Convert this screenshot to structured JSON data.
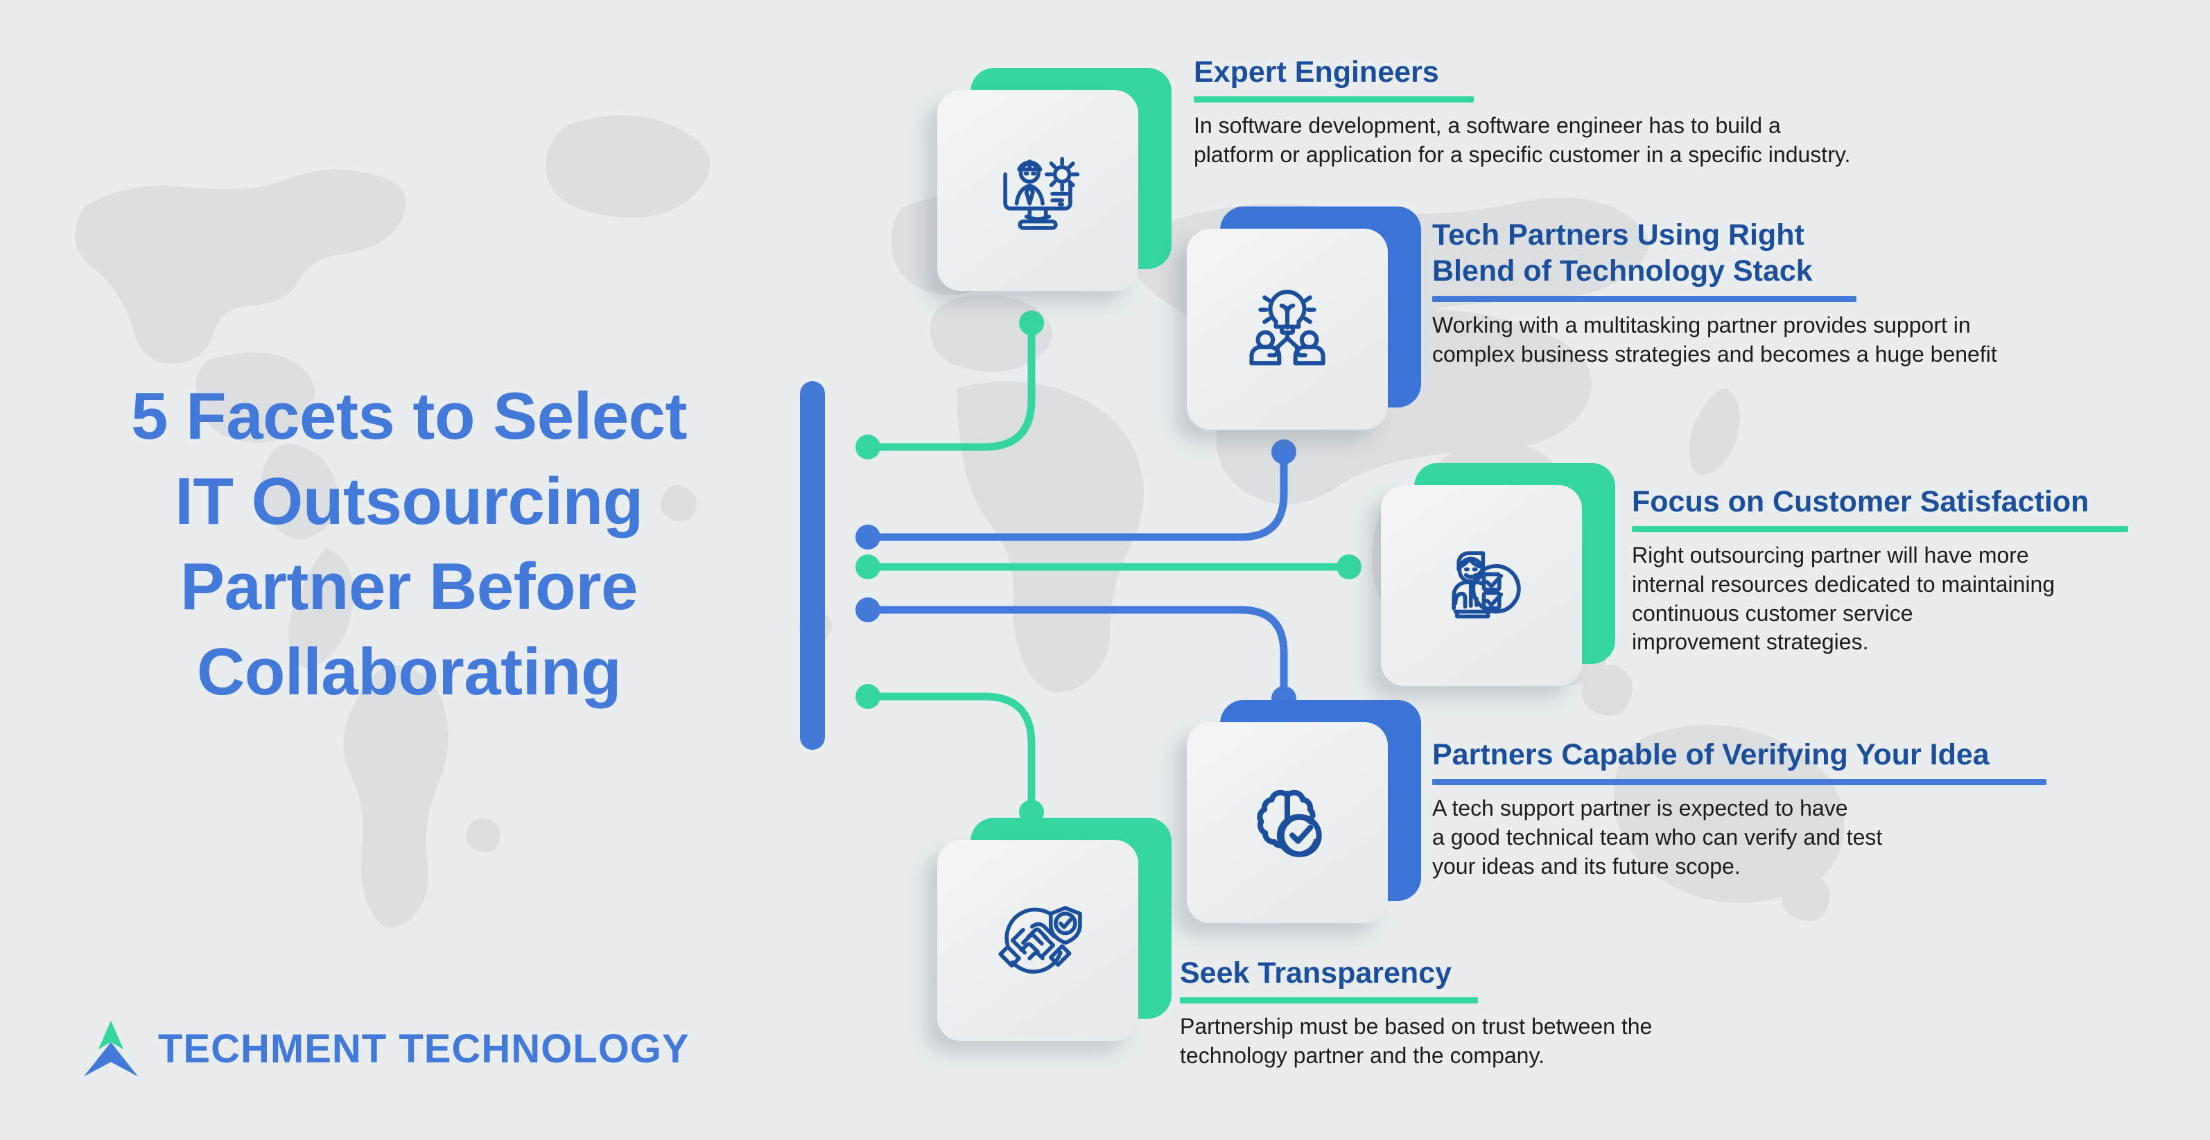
{
  "headline": {
    "lines": [
      "5 Facets to Select",
      "IT Outsourcing",
      "Partner Before",
      "Collaborating"
    ]
  },
  "colors": {
    "background": "#e9edef",
    "blue": "#4379d9",
    "green": "#35d6a0",
    "heading_blue": "#1b4f9c",
    "icon_blue": "#1b4f9c",
    "body_text": "#1c1c1c",
    "map_gray": "#dcdfe1"
  },
  "spine": {
    "label": "vertical-accent-bar",
    "color": "#4379d9"
  },
  "facets": [
    {
      "index": 1,
      "title": "Expert Engineers",
      "body": "In software development, a software engineer has to build a\nplatform or application for a specific customer in a specific industry.",
      "accent": "green",
      "icon": "engineer-monitor-gear-icon"
    },
    {
      "index": 2,
      "title": "Tech Partners Using Right\nBlend of Technology Stack",
      "title_line1": "Tech Partners Using Right",
      "title_line2": "Blend of Technology Stack",
      "body": "Working with a multitasking partner provides support in\ncomplex business strategies and becomes a huge benefit",
      "accent": "blue",
      "icon": "lightbulb-team-idea-icon"
    },
    {
      "index": 3,
      "title": "Focus on Customer Satisfaction",
      "body": "Right outsourcing partner will have more\ninternal resources dedicated to maintaining\ncontinuous customer service\nimprovement strategies.",
      "accent": "green",
      "icon": "person-checklist-satisfaction-icon"
    },
    {
      "index": 4,
      "title": "Partners Capable of Verifying Your Idea",
      "body": "A tech support partner is expected to have\na good technical team who can verify and test\nyour ideas and its future scope.",
      "accent": "blue",
      "icon": "brain-check-icon"
    },
    {
      "index": 5,
      "title": "Seek Transparency",
      "body": "Partnership must be based on trust between the\ntechnology partner and the company.",
      "accent": "green",
      "icon": "handshake-shield-icon"
    }
  ],
  "logo": {
    "wordmark": "TECHMENT TECHNOLOGY",
    "mark": "techment-chevron-logo-icon",
    "mark_top_color": "#35d6a0",
    "mark_bottom_color": "#4379d9"
  }
}
